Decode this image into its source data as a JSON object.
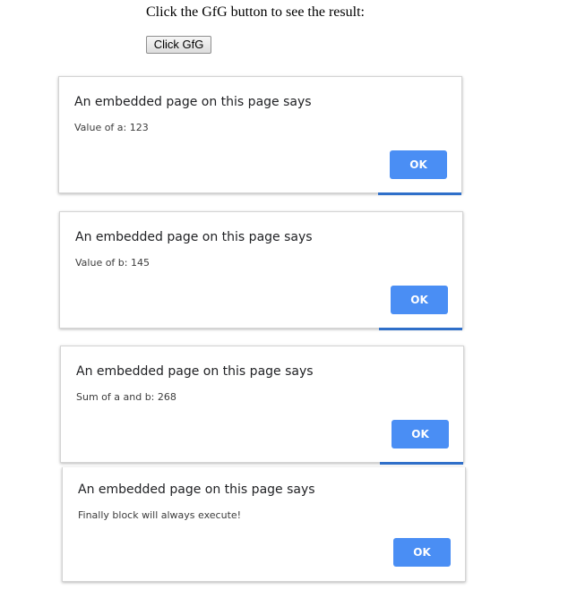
{
  "page": {
    "instruction_text": "Click the GfG button to see the result:",
    "button_label": "Click GfG"
  },
  "dialogs": [
    {
      "title": "An embedded page on this page says",
      "message": "Value of a: 123",
      "ok_label": "OK"
    },
    {
      "title": "An embedded page on this page says",
      "message": "Value of b: 145",
      "ok_label": "OK"
    },
    {
      "title": "An embedded page on this page says",
      "message": "Sum of a and b: 268",
      "ok_label": "OK"
    },
    {
      "title": "An embedded page on this page says",
      "message": "Finally block will always execute!",
      "ok_label": "OK"
    }
  ],
  "colors": {
    "ok_button_bg": "#4a8ef4",
    "ok_button_text": "#ffffff",
    "dialog_border": "#d4d4d4",
    "accent_edge": "#2f6fc9"
  }
}
